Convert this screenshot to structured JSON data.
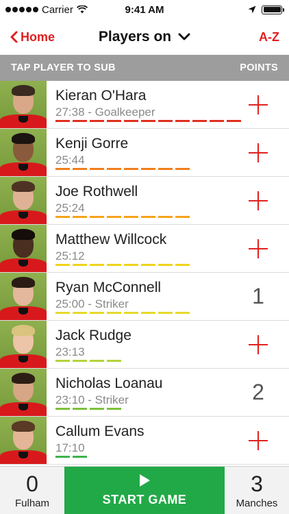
{
  "status_bar": {
    "carrier": "Carrier",
    "time": "9:41 AM",
    "icons": [
      "signal-dots",
      "wifi-icon",
      "location-arrow-icon",
      "battery-icon"
    ]
  },
  "nav": {
    "back_label": "Home",
    "title": "Players on",
    "sort_label": "A-Z"
  },
  "list_header": {
    "left": "TAP PLAYER TO SUB",
    "right": "POINTS"
  },
  "players": [
    {
      "name": "Kieran O'Hara",
      "meta": "27:38 - Goalkeeper",
      "points": "",
      "bar_color": "#e0301e",
      "bar_segments": 11,
      "skin": "#d9a889",
      "hair": "#3a2a20"
    },
    {
      "name": "Kenji Gorre",
      "meta": "25:44",
      "points": "",
      "bar_color": "#f07f1b",
      "bar_segments": 8,
      "skin": "#8a5a3c",
      "hair": "#1c1410"
    },
    {
      "name": "Joe Rothwell",
      "meta": "25:24",
      "points": "",
      "bar_color": "#f5a319",
      "bar_segments": 8,
      "skin": "#dfb296",
      "hair": "#4e3324"
    },
    {
      "name": "Matthew Willcock",
      "meta": "25:12",
      "points": "",
      "bar_color": "#f2d31b",
      "bar_segments": 8,
      "skin": "#4a2e1f",
      "hair": "#140d09"
    },
    {
      "name": "Ryan McConnell",
      "meta": "25:00 - Striker",
      "points": "1",
      "bar_color": "#e6d92a",
      "bar_segments": 8,
      "skin": "#e3b89c",
      "hair": "#2a1c14"
    },
    {
      "name": "Jack Rudge",
      "meta": "23:13",
      "points": "",
      "bar_color": "#b4d33a",
      "bar_segments": 4,
      "skin": "#ecc4a8",
      "hair": "#d9c37e"
    },
    {
      "name": "Nicholas Loanau",
      "meta": "23:10 - Striker",
      "points": "2",
      "bar_color": "#7cc13a",
      "bar_segments": 4,
      "skin": "#d6a685",
      "hair": "#2d1e15"
    },
    {
      "name": "Callum Evans",
      "meta": "17:10",
      "points": "",
      "bar_color": "#3db34a",
      "bar_segments": 2,
      "skin": "#e4b597",
      "hair": "#5a3a26"
    }
  ],
  "bottom": {
    "home_score": "0",
    "home_team": "Fulham",
    "start_label": "START GAME",
    "away_score": "3",
    "away_team": "Manches"
  }
}
